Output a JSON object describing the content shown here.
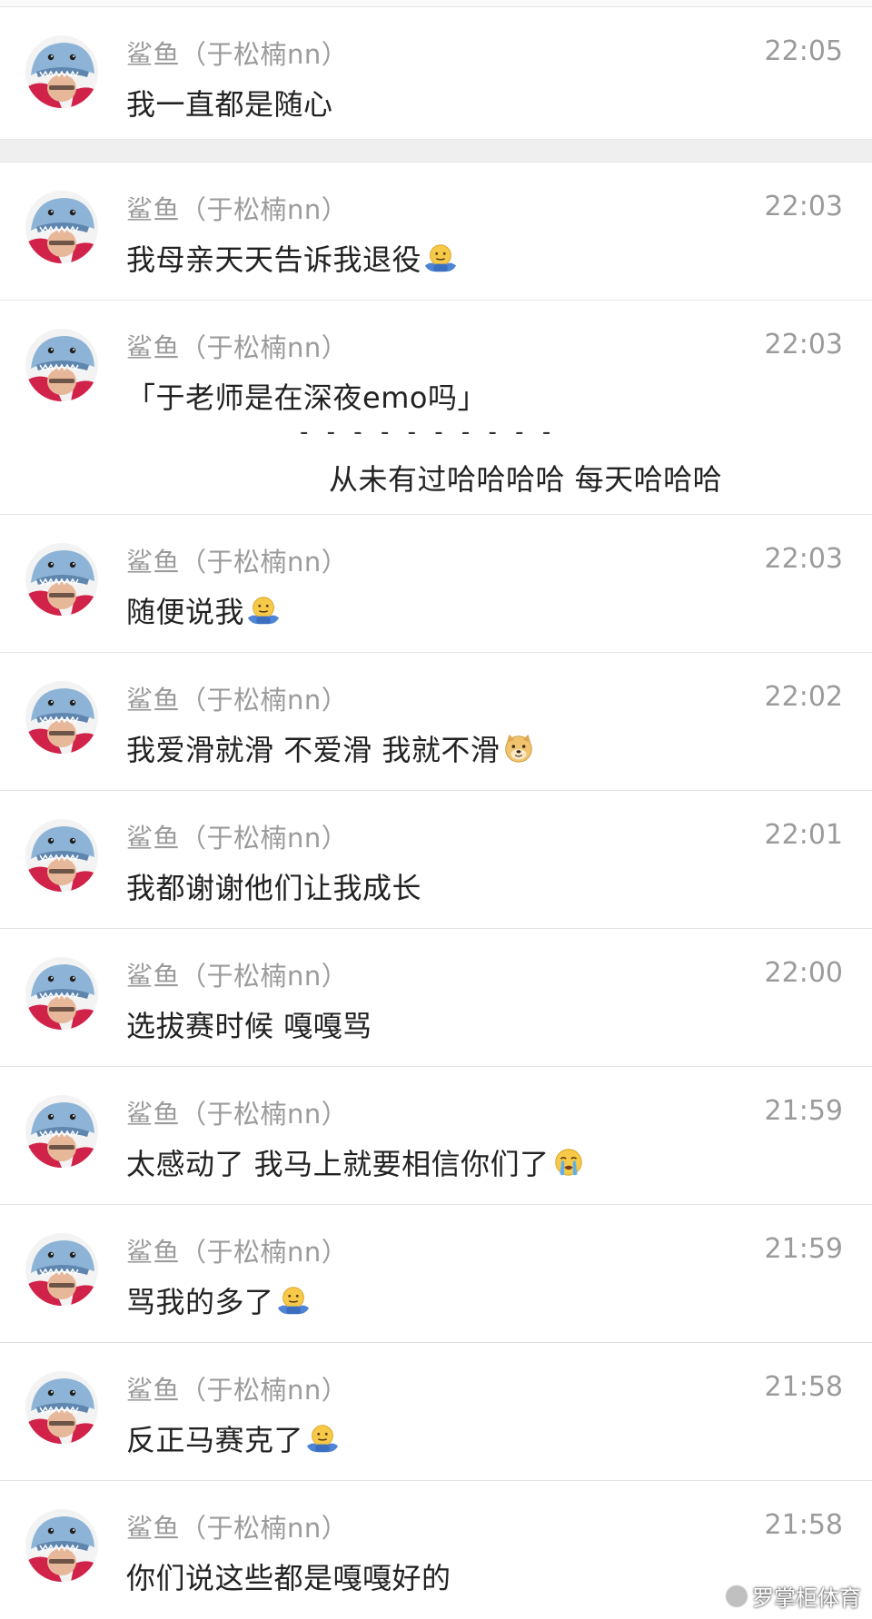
{
  "sender_name": "鲨鱼（于松楠nn）",
  "messages": [
    {
      "time": "22:05",
      "text": "我一直都是随心",
      "emoji": ""
    },
    {
      "time": "22:03",
      "text": "我母亲天天告诉我退役",
      "emoji": "shrug-emoji"
    },
    {
      "time": "22:03",
      "text": "「于老师是在深夜emo吗」",
      "emoji": "",
      "divider": "- - - - - - - - - -",
      "reply": "从未有过哈哈哈哈 每天哈哈哈"
    },
    {
      "time": "22:03",
      "text": "随便说我",
      "emoji": "shrug-emoji"
    },
    {
      "time": "22:02",
      "text": "我爱滑就滑 不爱滑 我就不滑",
      "emoji": "doge-emoji"
    },
    {
      "time": "22:01",
      "text": "我都谢谢他们让我成长",
      "emoji": ""
    },
    {
      "time": "22:00",
      "text": "选拔赛时候 嘎嘎骂",
      "emoji": ""
    },
    {
      "time": "21:59",
      "text": "太感动了 我马上就要相信你们了",
      "emoji": "crying-emoji"
    },
    {
      "time": "21:59",
      "text": "骂我的多了",
      "emoji": "shrug-emoji"
    },
    {
      "time": "21:58",
      "text": "反正马赛克了",
      "emoji": "shrug-emoji"
    },
    {
      "time": "21:58",
      "text": "你们说这些都是嘎嘎好的",
      "emoji": ""
    }
  ],
  "watermark": "罗掌柜体育",
  "colors": {
    "meta_gray": "#9b9b9b",
    "text_dark": "#222222",
    "separator": "#e3e3e3",
    "section_gap": "#efeff0"
  }
}
